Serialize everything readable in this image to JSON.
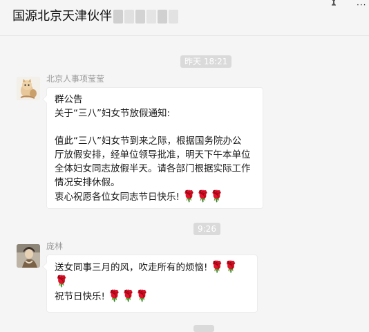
{
  "window": {
    "title": "国源北京天津伙伴",
    "pin_icon": "pin-icon",
    "more_icon": "more-icon",
    "more_glyph": "···"
  },
  "timestamps": [
    {
      "label": "昨天 18:21"
    },
    {
      "label": "9:26"
    }
  ],
  "messages": [
    {
      "sender": "北京人事项莹莹",
      "lines": [
        "群公告",
        "关于“三八”妇女节放假通知:",
        "",
        "值此“三八”妇女节到来之际，根据国务院办公",
        "厅放假安排，经单位领导批准，明天下午本单位",
        "全体妇女同志放假半天。请各部门根据实际工作",
        "情况安排休假。",
        "衷心祝愿各位女同志节日快乐!"
      ],
      "emoji": "🌹🌹🌹"
    },
    {
      "sender": "庞林",
      "lines": [
        "送女同事三月的风，吹走所有的烦恼!",
        "",
        "祝节日快乐!"
      ],
      "emoji_line1": "🌹🌹",
      "emoji_line2": "🌹",
      "emoji_line3": "🌹🌹🌹"
    }
  ]
}
